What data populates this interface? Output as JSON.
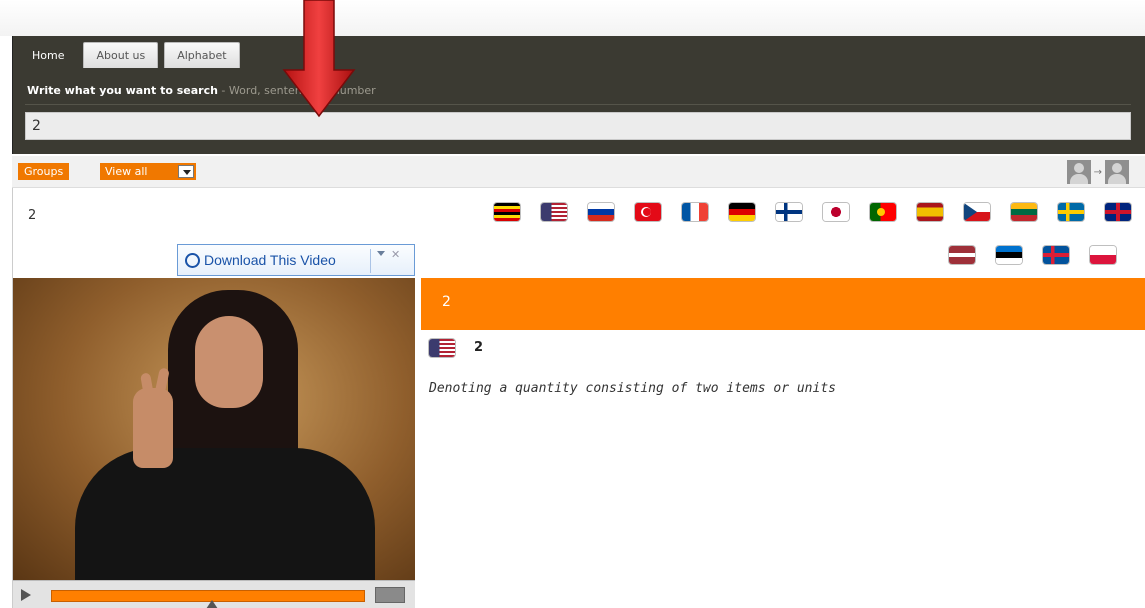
{
  "nav": {
    "tabs": [
      {
        "label": "Home",
        "active": true
      },
      {
        "label": "About us",
        "active": false
      },
      {
        "label": "Alphabet",
        "active": false
      }
    ]
  },
  "search": {
    "label": "Write what you want to search",
    "hint": " - Word, sentence or number",
    "value": "2"
  },
  "filter": {
    "groups_label": "Groups",
    "view_label": "View all"
  },
  "result": {
    "word": "2",
    "definition_word": "2",
    "definition": "Denoting a quantity consisting of two items or units",
    "language_flags": [
      "uganda",
      "usa",
      "russia",
      "turkey",
      "france",
      "germany",
      "finland",
      "japan",
      "portugal",
      "spain",
      "czech-republic",
      "lithuania",
      "sweden",
      "united-kingdom",
      "latvia",
      "estonia",
      "iceland",
      "poland"
    ]
  },
  "video": {
    "download_label": "Download This Video"
  },
  "colors": {
    "accent": "#ff7f00",
    "header_bg": "#3b3a32"
  }
}
